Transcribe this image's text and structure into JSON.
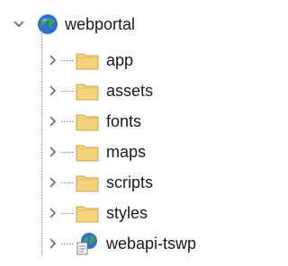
{
  "tree": {
    "root": {
      "label": "webportal",
      "icon": "globe-icon",
      "expanded": true
    },
    "children": [
      {
        "label": "app",
        "icon": "folder-icon"
      },
      {
        "label": "assets",
        "icon": "folder-icon"
      },
      {
        "label": "fonts",
        "icon": "folder-icon"
      },
      {
        "label": "maps",
        "icon": "folder-icon"
      },
      {
        "label": "scripts",
        "icon": "folder-icon"
      },
      {
        "label": "styles",
        "icon": "folder-icon"
      },
      {
        "label": "webapi-tswp",
        "icon": "web-project-icon"
      }
    ]
  },
  "colors": {
    "folder_fill": "#f5d37a",
    "folder_stroke": "#c8a24a",
    "globe_blue": "#2f6fcf",
    "globe_green": "#3fa34d",
    "chevron": "#6b6b6b",
    "tree_line": "#8a8a8a"
  }
}
